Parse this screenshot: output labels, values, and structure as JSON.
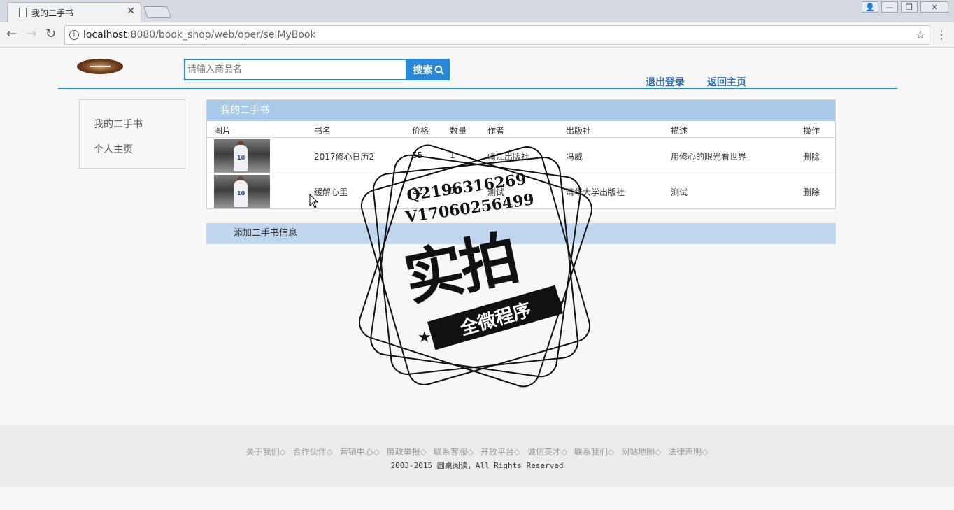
{
  "browser": {
    "tab_title": "我的二手书",
    "tab_close": "✕",
    "url_host": "localhost",
    "url_rest": ":8080/book_shop/web/oper/selMyBook",
    "back": "←",
    "forward": "→",
    "reload": "↻",
    "star": "☆",
    "menu": "⋮",
    "win_user": "👤",
    "win_min": "—",
    "win_max": "❐",
    "win_close": "✕"
  },
  "header": {
    "search_placeholder": "请输入商品名",
    "search_button": "搜索",
    "logout": "退出登录",
    "home": "返回主页"
  },
  "sidebar": {
    "items": [
      {
        "label": "我的二手书"
      },
      {
        "label": "个人主页"
      }
    ]
  },
  "panel": {
    "title": "我的二手书",
    "columns": [
      "图片",
      "书名",
      "价格",
      "数量",
      "作者",
      "出版社",
      "描述",
      "操作"
    ],
    "rows": [
      {
        "name": "2017修心日历2",
        "price": "55",
        "qty": "1",
        "author": "骚江出版社",
        "publisher": "冯威",
        "desc": "用修心的眼光看世界",
        "action": "删除",
        "jersey": "10"
      },
      {
        "name": "缓解心里",
        "price": "22",
        "qty": "50",
        "author": "测试",
        "publisher": "清华大学出版社",
        "desc": "测试",
        "action": "删除",
        "jersey": "10"
      }
    ]
  },
  "add_label": "添加二手书信息",
  "footer": {
    "links": [
      "关于我们◇",
      "合作伙伴◇",
      "营销中心◇",
      "廉政举报◇",
      "联系客服◇",
      "开放平台◇",
      "诚信英才◇",
      "联系我们◇",
      "网站地图◇",
      "法律声明◇"
    ],
    "copyright": "2003-2015 圆桌阅读，All Rights Reserved"
  },
  "watermark": {
    "line1": "Q2196316269",
    "line2": "V17060256499",
    "big": "实拍",
    "ribbon": "全微程序",
    "star": "★"
  }
}
